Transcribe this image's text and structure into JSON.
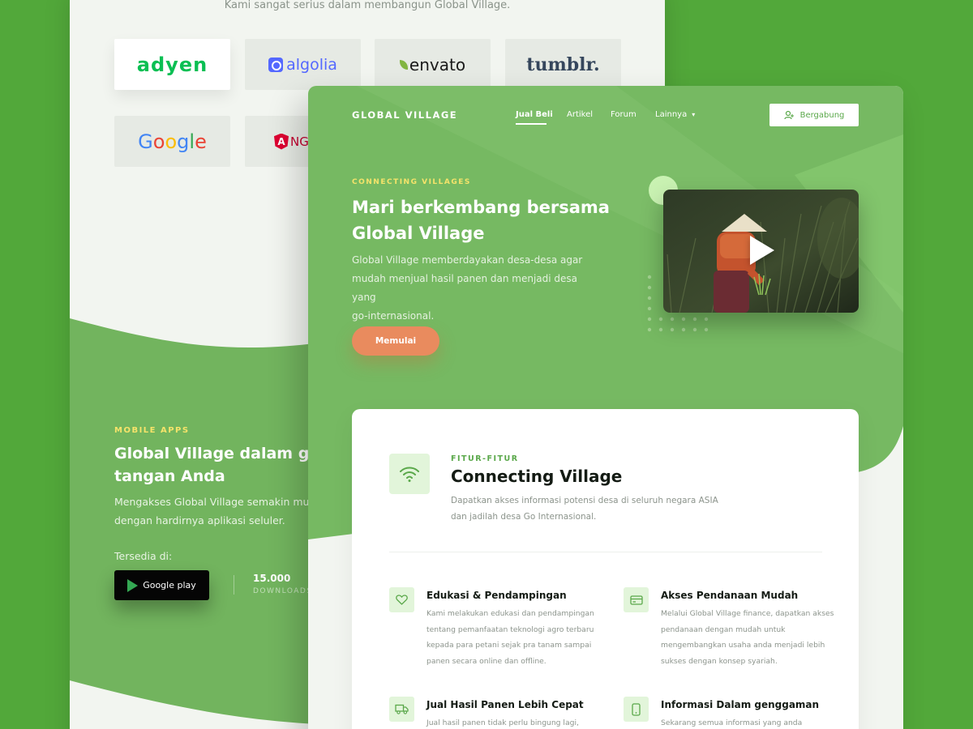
{
  "back": {
    "intro": "Kami sangat serius dalam membangun Global Village.",
    "logos": [
      "adyen",
      "algolia",
      "envato",
      "tumblr.",
      "Google",
      "NGU"
    ],
    "angular_mark": "A",
    "apps_label": "MOBILE APPS",
    "apps_title": "Global Village dalam gengg… tangan Anda",
    "apps_title_line1": "Global Village dalam gengg",
    "apps_title_line2": "tangan Anda",
    "apps_desc_line1": "Mengakses Global Village semakin muda",
    "apps_desc_line2": "dengan hardirnya aplikasi seluler.",
    "available": "Tersedia di:",
    "store": "Google play",
    "downloads_value": "15.000",
    "downloads_label": "DOWNLOADS"
  },
  "front": {
    "brand": "GLOBAL VILLAGE",
    "nav": [
      "Jual Beli",
      "Artikel",
      "Forum",
      "Lainnya"
    ],
    "nav_caret": "▾",
    "join": "Bergabung",
    "hero": {
      "eyebrow": "CONNECTING VILLAGES",
      "title_line1": "Mari berkembang bersama",
      "title_line2": "Global Village",
      "desc_line1": "Global Village memberdayakan desa-desa agar",
      "desc_line2": "mudah menjual hasil panen dan menjadi desa yang",
      "desc_line3": "go-internasional.",
      "cta": "Memulai"
    },
    "features": {
      "eyebrow": "FITUR-FITUR",
      "title": "Connecting Village",
      "desc_line1": "Dapatkan akses informasi potensi desa di seluruh negara ASIA",
      "desc_line2": "dan jadilah desa Go Internasional.",
      "items": [
        {
          "icon": "heart-icon",
          "title": "Edukasi & Pendampingan",
          "desc": "Kami melakukan edukasi dan pendampingan tentang pemanfaatan teknologi agro terbaru kepada para petani sejak pra tanam sampai panen secara online dan offline."
        },
        {
          "icon": "credit-card-icon",
          "title": "Akses Pendanaan Mudah",
          "desc": "Melalui Global Village finance, dapatkan akses pendanaan dengan mudah untuk mengembangkan usaha anda menjadi lebih sukses dengan konsep syariah."
        },
        {
          "icon": "truck-icon",
          "title": "Jual Hasil Panen Lebih Cepat",
          "desc": "Jual hasil panen tidak perlu bingung lagi,"
        },
        {
          "icon": "smartphone-icon",
          "title": "Informasi Dalam genggaman",
          "desc": "Sekarang semua informasi yang anda"
        }
      ]
    }
  },
  "colors": {
    "background": "#52a83a",
    "accent_green": "#5aa84a",
    "hero_green": "#76b962",
    "cta_orange": "#e98b5e",
    "eyebrow_yellow": "#f5e36a"
  }
}
